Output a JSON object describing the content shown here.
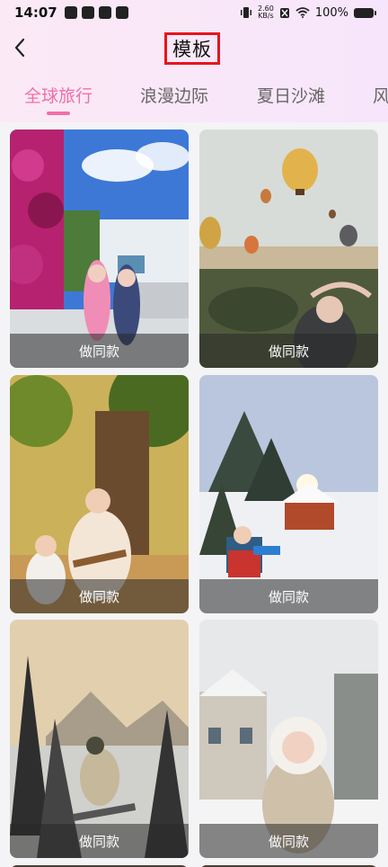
{
  "status_bar": {
    "time": "14:07",
    "net_speed": "2.60\nKB/s",
    "battery": "100%"
  },
  "header": {
    "title": "模板"
  },
  "tabs": [
    {
      "label": "全球旅行",
      "active": true
    },
    {
      "label": "浪漫边际",
      "active": false
    },
    {
      "label": "夏日沙滩",
      "active": false
    },
    {
      "label": "风",
      "active": false
    }
  ],
  "cards": [
    {
      "label": "做同款",
      "scene": "garden-terrace-girls"
    },
    {
      "label": "做同款",
      "scene": "hot-air-balloons"
    },
    {
      "label": "做同款",
      "scene": "mother-child-tree"
    },
    {
      "label": "做同款",
      "scene": "snow-cabin-child"
    },
    {
      "label": "做同款",
      "scene": "winter-forest-snowboarder"
    },
    {
      "label": "做同款",
      "scene": "snow-village-girl"
    }
  ],
  "colors": {
    "accent": "#f06fa8",
    "title_highlight": "#e8141d"
  }
}
